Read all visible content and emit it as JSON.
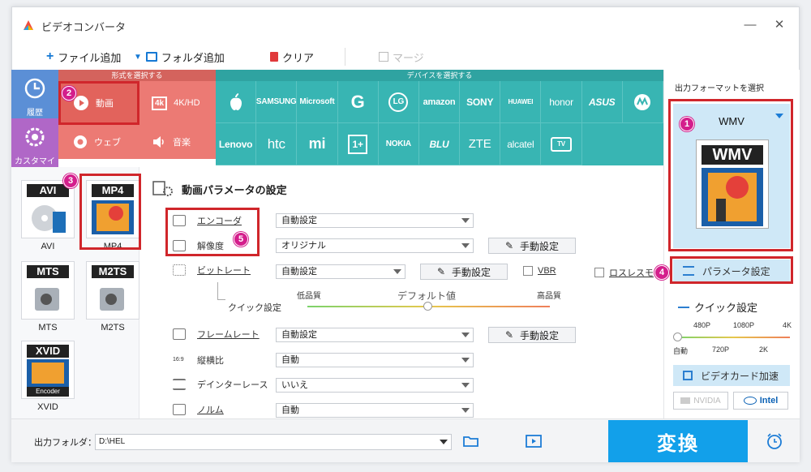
{
  "window": {
    "title": "ビデオコンバータ",
    "minimize": "—",
    "close": "✕"
  },
  "toolbar": {
    "add_file": "ファイル追加",
    "add_folder": "フォルダ追加",
    "clear": "クリア",
    "merge": "マージ"
  },
  "categories": {
    "format_header": "形式を選択する",
    "device_header": "デバイスを選択する",
    "history": "履歴",
    "custom": "カスタマイズ",
    "video": "動画",
    "hd": "4K/HD",
    "web": "ウェブ",
    "music": "音楽"
  },
  "devices": [
    "",
    "SAMSUNG",
    "Microsoft",
    "G",
    "LG",
    "amazon",
    "SONY",
    "HUAWEI",
    "honor",
    "ASUS",
    "",
    "",
    "Lenovo",
    "htc",
    "mi",
    "1+",
    "NOKIA",
    "BLU",
    "ZTE",
    "alcatel",
    "TV"
  ],
  "formats": [
    {
      "label": "AVI"
    },
    {
      "label": "MP4"
    },
    {
      "label": "MTS"
    },
    {
      "label": "M2TS"
    },
    {
      "label": "XVID",
      "sub": "Encoder"
    }
  ],
  "params": {
    "title": "動画パラメータの設定",
    "encoder_label": "エンコーダ",
    "encoder_value": "自動設定",
    "resolution_label": "解像度",
    "resolution_value": "オリジナル",
    "manual": "手動設定",
    "bitrate_label": "ビットレート",
    "bitrate_value": "自動設定",
    "vbr": "VBR",
    "lossless": "ロスレスモ",
    "quick_label": "クイック設定",
    "low_quality": "低品質",
    "default_value": "デフォルト値",
    "high_quality": "高品質",
    "framerate_label": "フレームレート",
    "framerate_value": "自動設定",
    "aspect_label": "縦横比",
    "aspect_value": "自動",
    "deinterlace_label": "デインターレース",
    "deinterlace_value": "いいえ",
    "norm_label": "ノルム",
    "norm_value": "自動"
  },
  "right": {
    "select_output": "出力フォーマットを選択",
    "output_format": "WMV",
    "param_settings": "パラメータ設定",
    "quick_settings": "クイック設定",
    "ticks_top": [
      "480P",
      "1080P",
      "4K"
    ],
    "ticks_bottom": [
      "自動",
      "720P",
      "2K"
    ],
    "gpu_accel": "ビデオカード加速",
    "nvidia": "NVIDIA",
    "intel": "Intel"
  },
  "bottom": {
    "output_folder_label": "出力フォルダ：",
    "output_path": "D:\\HEL",
    "convert": "変換"
  },
  "badges": [
    "1",
    "2",
    "3",
    "4",
    "5"
  ],
  "colors": {
    "accent": "#12a0ea",
    "teal": "#38b5b3",
    "coral": "#e86c65",
    "purple": "#b067c7",
    "blue": "#5b8fd6",
    "highlight": "#d0262b",
    "badge": "#d41e8c"
  }
}
